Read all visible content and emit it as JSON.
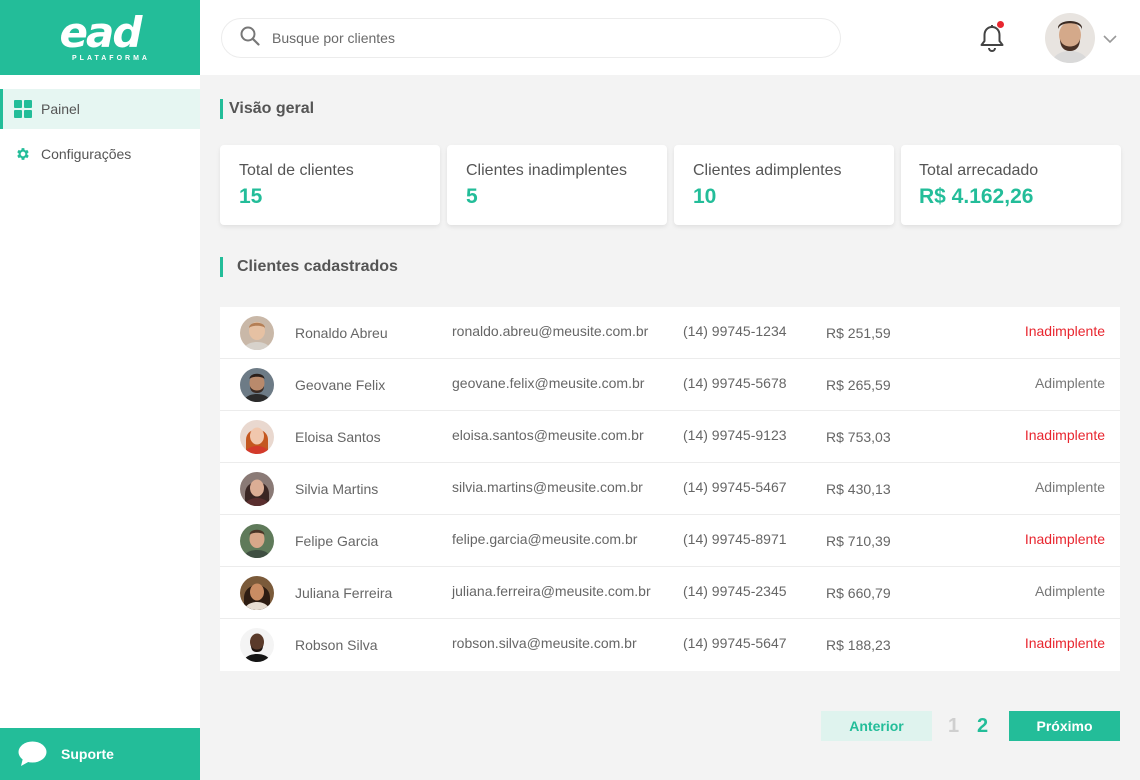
{
  "brand": {
    "logo_text": "ead",
    "logo_subtitle": "PLATAFORMA",
    "color": "#23bd99",
    "alert_color": "#e8262f"
  },
  "sidebar": {
    "items": [
      {
        "label": "Painel",
        "icon": "grid-icon",
        "active": true
      },
      {
        "label": "Configurações",
        "icon": "gear-icon",
        "active": false
      }
    ],
    "support": {
      "label": "Suporte",
      "icon": "chat-bubble-icon"
    }
  },
  "header": {
    "search": {
      "placeholder": "Busque por clientes",
      "value": ""
    },
    "notifications": {
      "icon": "bell-icon",
      "has_unread": true
    },
    "user_menu": {
      "icon": "chevron-down-icon"
    }
  },
  "overview": {
    "title": "Visão geral",
    "cards": [
      {
        "label": "Total de clientes",
        "value": "15"
      },
      {
        "label": "Clientes inadimplentes",
        "value": "5"
      },
      {
        "label": "Clientes adimplentes",
        "value": "10"
      },
      {
        "label": "Total arrecadado",
        "value": "R$ 4.162,26"
      }
    ]
  },
  "clients": {
    "title": "Clientes cadastrados",
    "rows": [
      {
        "name": "Ronaldo Abreu",
        "email": "ronaldo.abreu@meusite.com.br",
        "phone": "(14) 99745-1234",
        "amount": "R$ 251,59",
        "status": "Inadimplente"
      },
      {
        "name": "Geovane Felix",
        "email": "geovane.felix@meusite.com.br",
        "phone": "(14) 99745-5678",
        "amount": "R$ 265,59",
        "status": "Adimplente"
      },
      {
        "name": "Eloisa Santos",
        "email": "eloisa.santos@meusite.com.br",
        "phone": "(14) 99745-9123",
        "amount": "R$ 753,03",
        "status": "Inadimplente"
      },
      {
        "name": "Silvia Martins",
        "email": "silvia.martins@meusite.com.br",
        "phone": "(14) 99745-5467",
        "amount": "R$ 430,13",
        "status": "Adimplente"
      },
      {
        "name": "Felipe Garcia",
        "email": "felipe.garcia@meusite.com.br",
        "phone": "(14) 99745-8971",
        "amount": "R$ 710,39",
        "status": "Inadimplente"
      },
      {
        "name": "Juliana Ferreira",
        "email": "juliana.ferreira@meusite.com.br",
        "phone": "(14) 99745-2345",
        "amount": "R$ 660,79",
        "status": "Adimplente"
      },
      {
        "name": "Robson Silva",
        "email": "robson.silva@meusite.com.br",
        "phone": "(14) 99745-5647",
        "amount": "R$ 188,23",
        "status": "Inadimplente"
      }
    ]
  },
  "pagination": {
    "prev_label": "Anterior",
    "next_label": "Próximo",
    "pages": [
      "1",
      "2"
    ],
    "current_page": "2"
  }
}
